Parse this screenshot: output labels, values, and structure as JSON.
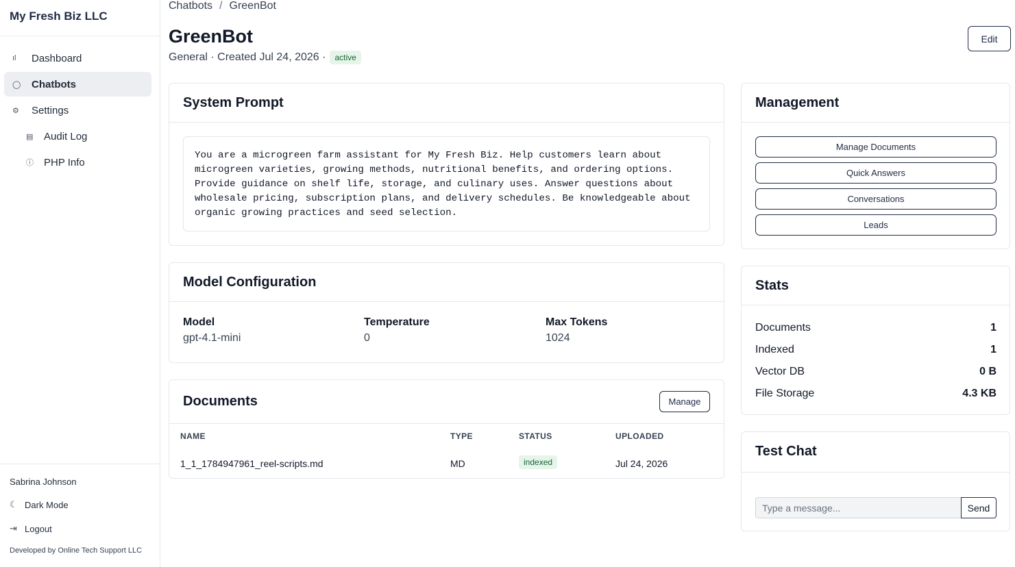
{
  "sidebar": {
    "brand": "My Fresh Biz LLC",
    "items": [
      {
        "label": "Dashboard",
        "icon": "bar-chart-icon",
        "glyph": "ıl"
      },
      {
        "label": "Chatbots",
        "icon": "chat-bubble-icon",
        "glyph": "◯"
      },
      {
        "label": "Settings",
        "icon": "gear-icon",
        "glyph": "⚙"
      },
      {
        "label": "Audit Log",
        "icon": "document-list-icon",
        "glyph": "▤"
      },
      {
        "label": "PHP Info",
        "icon": "info-icon",
        "glyph": "ⓘ"
      }
    ],
    "user_name": "Sabrina Johnson",
    "dark_mode": {
      "label": "Dark Mode",
      "glyph": "☾"
    },
    "logout": {
      "label": "Logout",
      "glyph": "⇥"
    },
    "credit": "Developed by Online Tech Support LLC"
  },
  "breadcrumb": {
    "parent": "Chatbots",
    "sep": "/",
    "current": "GreenBot"
  },
  "header": {
    "title": "GreenBot",
    "subtitle": "General · Created Jul 24, 2026 ·",
    "status": "active",
    "edit_label": "Edit"
  },
  "system_prompt": {
    "title": "System Prompt",
    "text": "You are a microgreen farm assistant for My Fresh Biz. Help customers learn about\nmicrogreen varieties, growing methods, nutritional benefits, and ordering options.\nProvide guidance on shelf life, storage, and culinary uses. Answer questions about\nwholesale pricing, subscription plans, and delivery schedules. Be knowledgeable about\norganic growing practices and seed selection."
  },
  "model_config": {
    "title": "Model Configuration",
    "model_label": "Model",
    "model_value": "gpt-4.1-mini",
    "temp_label": "Temperature",
    "temp_value": "0",
    "tokens_label": "Max Tokens",
    "tokens_value": "1024"
  },
  "documents": {
    "title": "Documents",
    "manage_label": "Manage",
    "columns": [
      "NAME",
      "TYPE",
      "STATUS",
      "UPLOADED"
    ],
    "rows": [
      {
        "name": "1_1_1784947961_reel-scripts.md",
        "type": "MD",
        "status": "indexed",
        "uploaded": "Jul 24, 2026"
      }
    ]
  },
  "management": {
    "title": "Management",
    "buttons": [
      "Manage Documents",
      "Quick Answers",
      "Conversations",
      "Leads"
    ]
  },
  "stats": {
    "title": "Stats",
    "rows": [
      {
        "label": "Documents",
        "value": "1"
      },
      {
        "label": "Indexed",
        "value": "1"
      },
      {
        "label": "Vector DB",
        "value": "0 B"
      },
      {
        "label": "File Storage",
        "value": "4.3 KB"
      }
    ]
  },
  "test_chat": {
    "title": "Test Chat",
    "placeholder": "Type a message...",
    "send_label": "Send"
  },
  "colors": {
    "accent": "#1f2a44",
    "active_nav_bg": "#eceef2",
    "badge_bg": "#e6f4ea",
    "badge_text": "#166534"
  }
}
